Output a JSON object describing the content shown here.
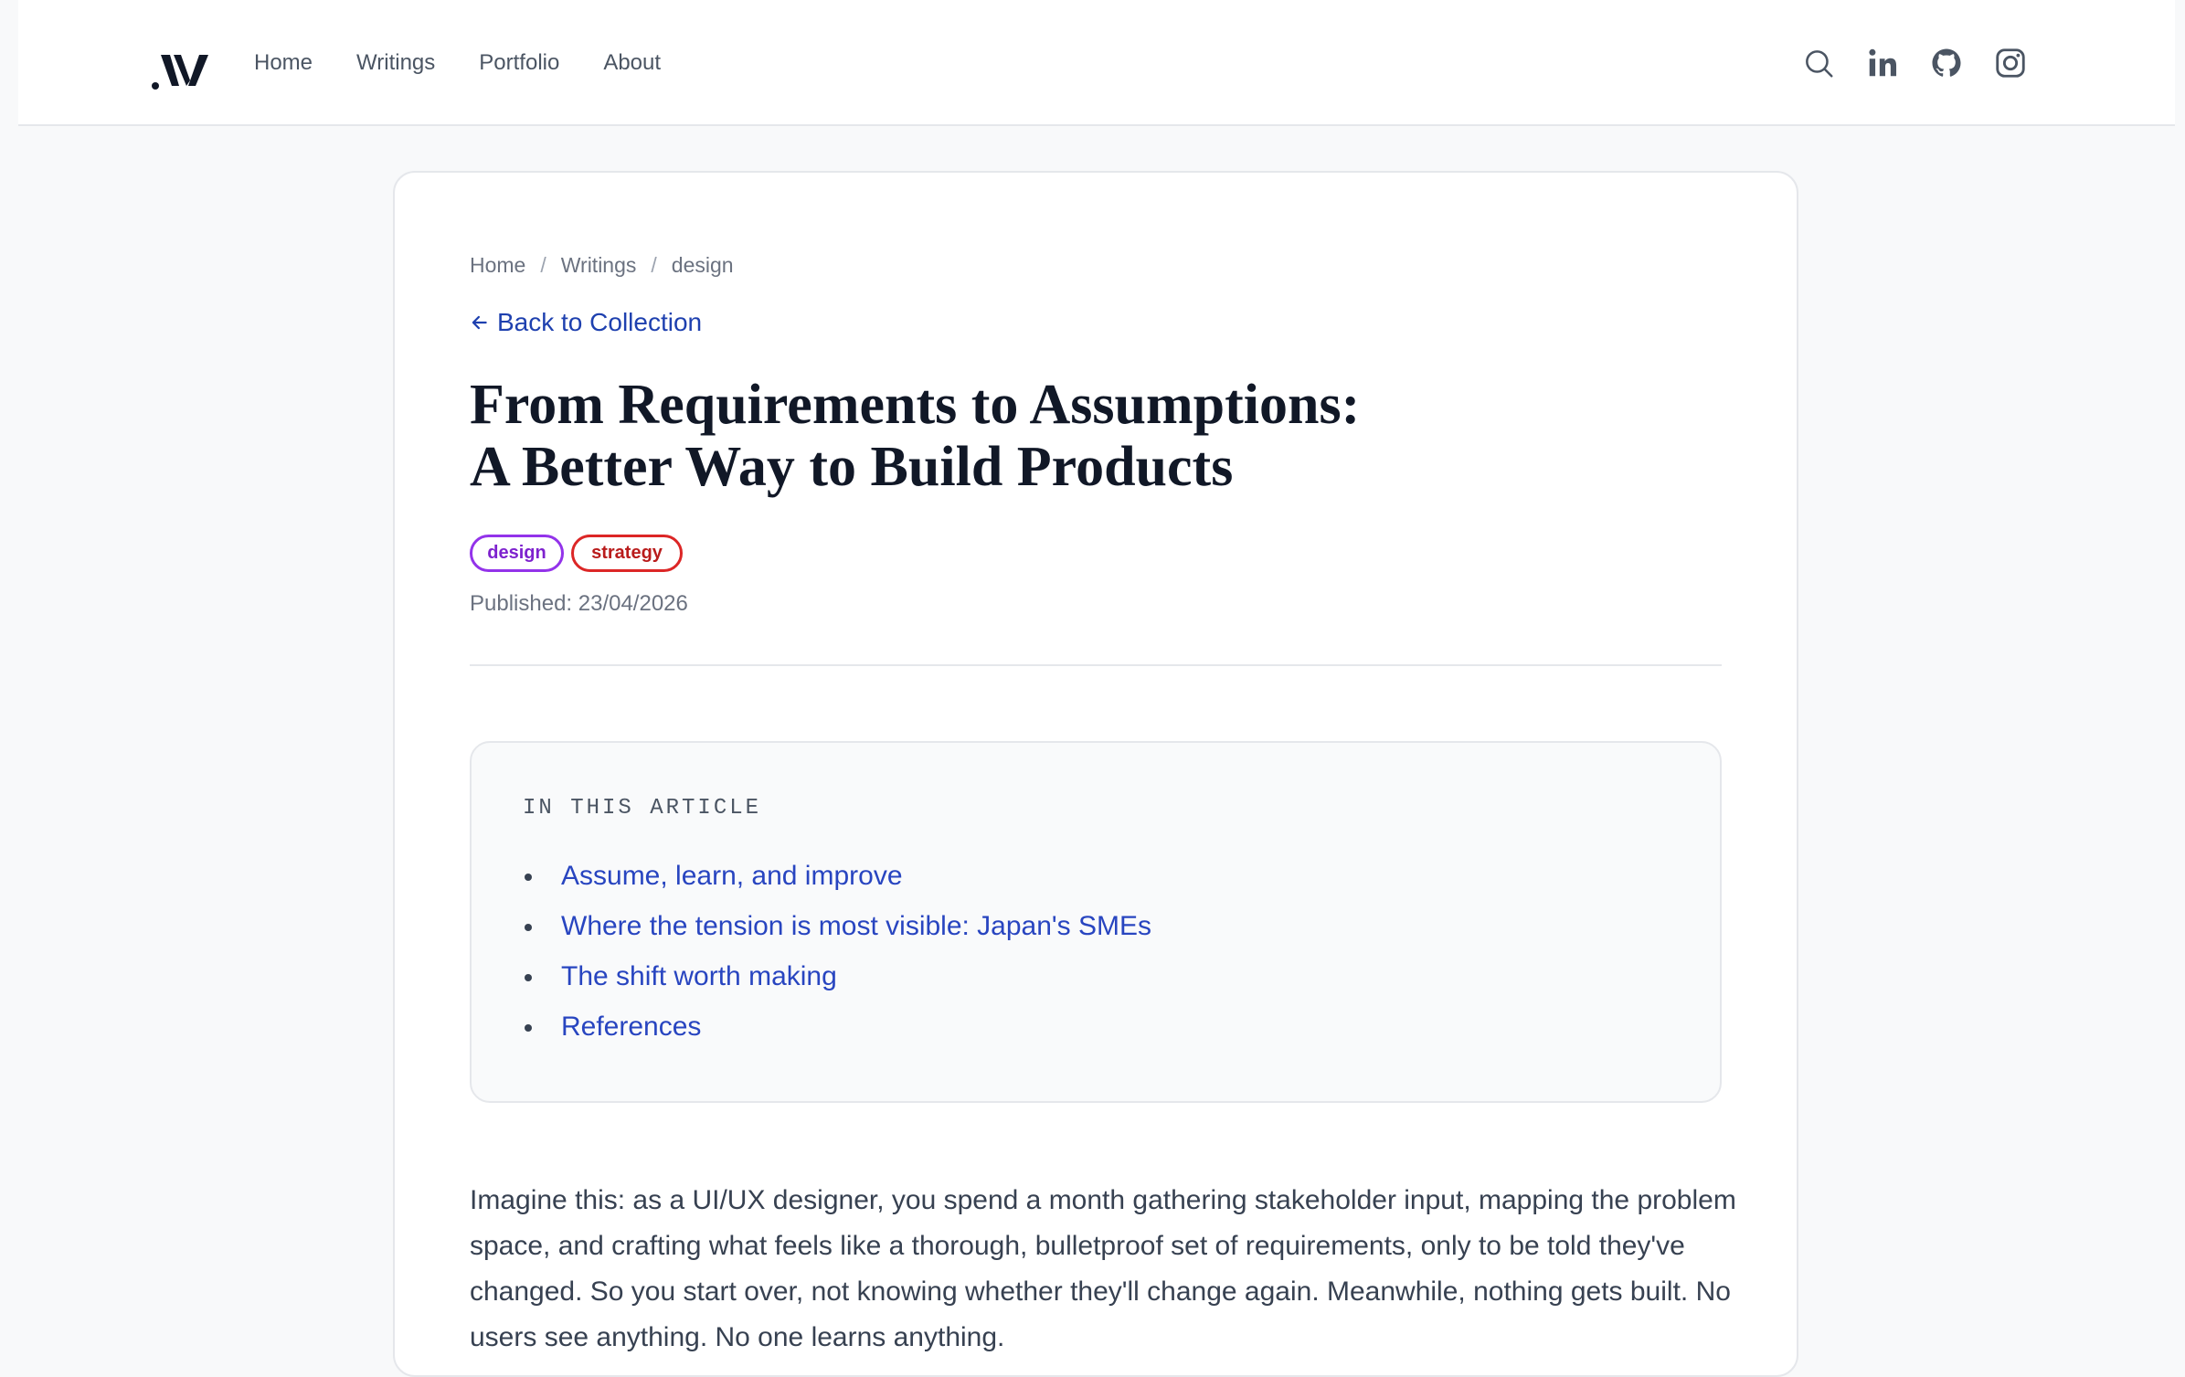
{
  "header": {
    "logo_alt": "W",
    "nav": [
      "Home",
      "Writings",
      "Portfolio",
      "About"
    ],
    "icons": [
      "search-icon",
      "linkedin-icon",
      "github-icon",
      "instagram-icon"
    ]
  },
  "breadcrumb": [
    "Home",
    "Writings",
    "design"
  ],
  "back_link": "Back to Collection",
  "title_line1": "From Requirements to Assumptions:",
  "title_line2": "A Better Way to Build Products",
  "tags": [
    "design",
    "strategy"
  ],
  "published": "Published: 23/04/2026",
  "toc": {
    "heading": "IN THIS ARTICLE",
    "items": [
      "Assume, learn, and improve",
      "Where the tension is most visible: Japan's SMEs",
      "The shift worth making",
      "References"
    ]
  },
  "body": {
    "paragraph": "Imagine this: as a UI/UX designer, you spend a month gathering stakeholder input, mapping the problem space, and crafting what feels like a thorough, bulletproof set of requirements, only to be told they've changed. So you start over, not knowing whether they'll change again. Meanwhile, nothing gets built. No users see anything. No one learns anything."
  },
  "colors": {
    "link": "#2845c0",
    "tag_design": "#9333ea",
    "tag_strategy": "#dc2626"
  }
}
